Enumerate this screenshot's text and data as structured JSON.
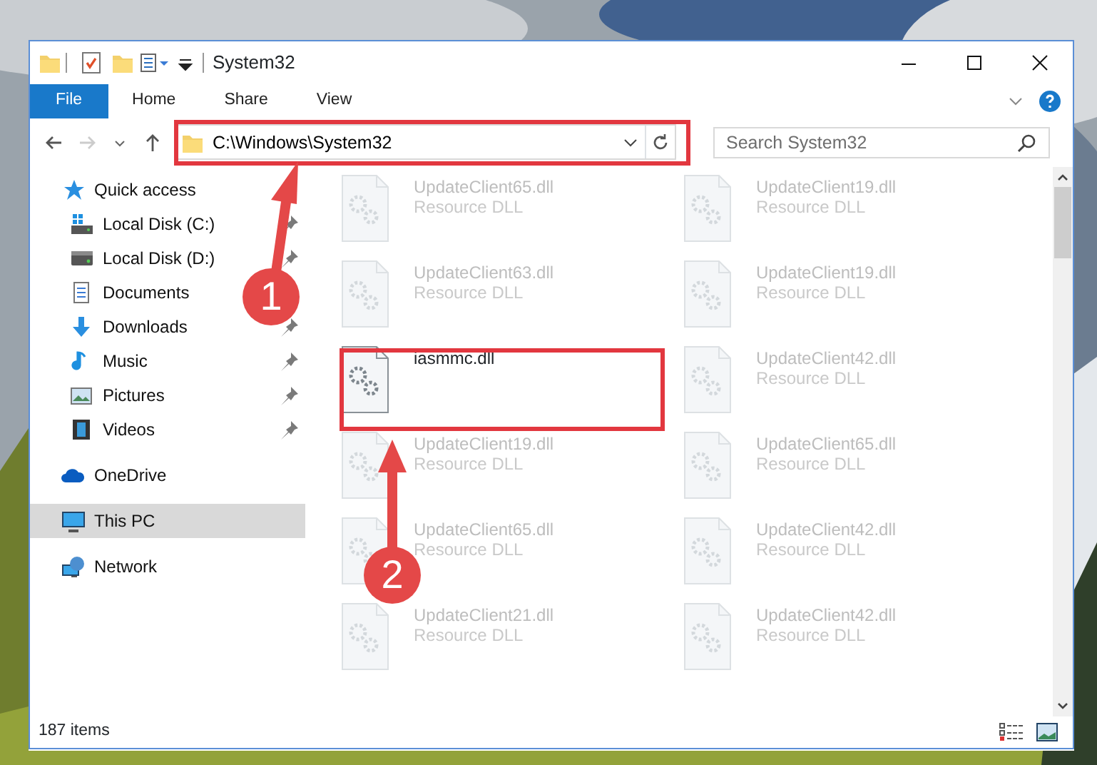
{
  "window": {
    "title": "System32"
  },
  "ribbon_tabs": [
    {
      "label": "File",
      "selected": true
    },
    {
      "label": "Home",
      "selected": false
    },
    {
      "label": "Share",
      "selected": false
    },
    {
      "label": "View",
      "selected": false
    }
  ],
  "address": {
    "path": "C:\\Windows\\System32"
  },
  "search": {
    "placeholder": "Search System32"
  },
  "nav": [
    {
      "label": "Quick access",
      "kind": "star",
      "selected": false,
      "children": [
        {
          "label": "Local Disk (C:)",
          "kind": "drive-c",
          "pinned": true,
          "selected": false
        },
        {
          "label": "Local Disk (D:)",
          "kind": "drive",
          "pinned": true,
          "selected": false
        },
        {
          "label": "Documents",
          "kind": "docs",
          "selected": false
        },
        {
          "label": "Downloads",
          "kind": "download",
          "pinned": true,
          "selected": false
        },
        {
          "label": "Music",
          "kind": "music",
          "pinned": true,
          "selected": false
        },
        {
          "label": "Pictures",
          "kind": "pictures",
          "pinned": true,
          "selected": false
        },
        {
          "label": "Videos",
          "kind": "videos",
          "pinned": true,
          "selected": false
        }
      ]
    },
    {
      "label": "OneDrive",
      "kind": "cloud",
      "selected": false
    },
    {
      "label": "This PC",
      "kind": "pc",
      "selected": true
    },
    {
      "label": "Network",
      "kind": "network",
      "selected": false
    }
  ],
  "files": [
    {
      "name": "UpdateClient65.dll",
      "type": "Resource DLL",
      "faded": true
    },
    {
      "name": "UpdateClient19.dll",
      "type": "Resource DLL",
      "faded": true
    },
    {
      "name": "UpdateClient63.dll",
      "type": "Resource DLL",
      "faded": true
    },
    {
      "name": "UpdateClient19.dll",
      "type": "Resource DLL",
      "faded": true
    },
    {
      "name": "iasmmc.dll",
      "faded": false
    },
    {
      "name": "UpdateClient42.dll",
      "type": "Resource DLL",
      "faded": true
    },
    {
      "name": "UpdateClient19.dll",
      "type": "Resource DLL",
      "faded": true
    },
    {
      "name": "UpdateClient65.dll",
      "type": "Resource DLL",
      "faded": true
    },
    {
      "name": "UpdateClient65.dll",
      "type": "Resource DLL",
      "faded": true
    },
    {
      "name": "UpdateClient42.dll",
      "type": "Resource DLL",
      "faded": true
    },
    {
      "name": "UpdateClient21.dll",
      "type": "Resource DLL",
      "faded": true
    },
    {
      "name": "UpdateClient42.dll",
      "type": "Resource DLL",
      "faded": true
    }
  ],
  "status_bar": {
    "item_count": "187 items"
  },
  "annotations": [
    {
      "label": "1"
    },
    {
      "label": "2"
    }
  ]
}
